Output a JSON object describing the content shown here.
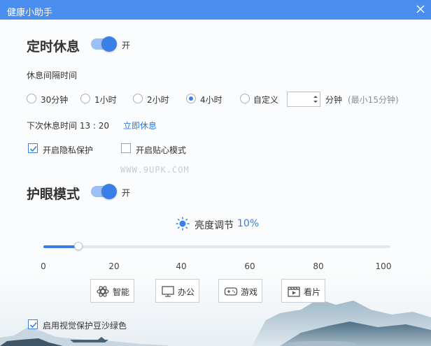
{
  "window": {
    "title": "健康小助手"
  },
  "rest": {
    "heading": "定时休息",
    "toggle_label": "开",
    "interval_label": "休息间隔时间",
    "options": [
      {
        "label": "30分钟",
        "selected": false
      },
      {
        "label": "1小时",
        "selected": false
      },
      {
        "label": "2小时",
        "selected": false
      },
      {
        "label": "4小时",
        "selected": true
      },
      {
        "label": "自定义",
        "selected": false
      }
    ],
    "custom_value": "",
    "custom_unit": "分钟",
    "custom_hint": "(最小15分钟)",
    "next_rest": "下次休息时间 13 : 20",
    "rest_now": "立即休息",
    "privacy": {
      "label": "开启隐私保护",
      "checked": true
    },
    "sticky": {
      "label": "开启贴心模式",
      "checked": false
    }
  },
  "watermark": "WWW.9UPK.COM",
  "eye": {
    "heading": "护眼模式",
    "toggle_label": "开",
    "brightness_label": "亮度调节",
    "brightness_value": "10%",
    "brightness_level": 10,
    "ticks": [
      "0",
      "20",
      "40",
      "60",
      "80",
      "100"
    ],
    "modes": [
      {
        "label": "智能",
        "icon": "smart-icon"
      },
      {
        "label": "办公",
        "icon": "monitor-icon"
      },
      {
        "label": "游戏",
        "icon": "gamepad-icon"
      },
      {
        "label": "看片",
        "icon": "film-icon"
      }
    ],
    "green_mode": {
      "label": "启用视觉保护豆沙绿色",
      "checked": true
    }
  },
  "colors": {
    "accent": "#3a7ee8",
    "titlebar": "#4a8ef0",
    "link": "#2a7ae2"
  }
}
